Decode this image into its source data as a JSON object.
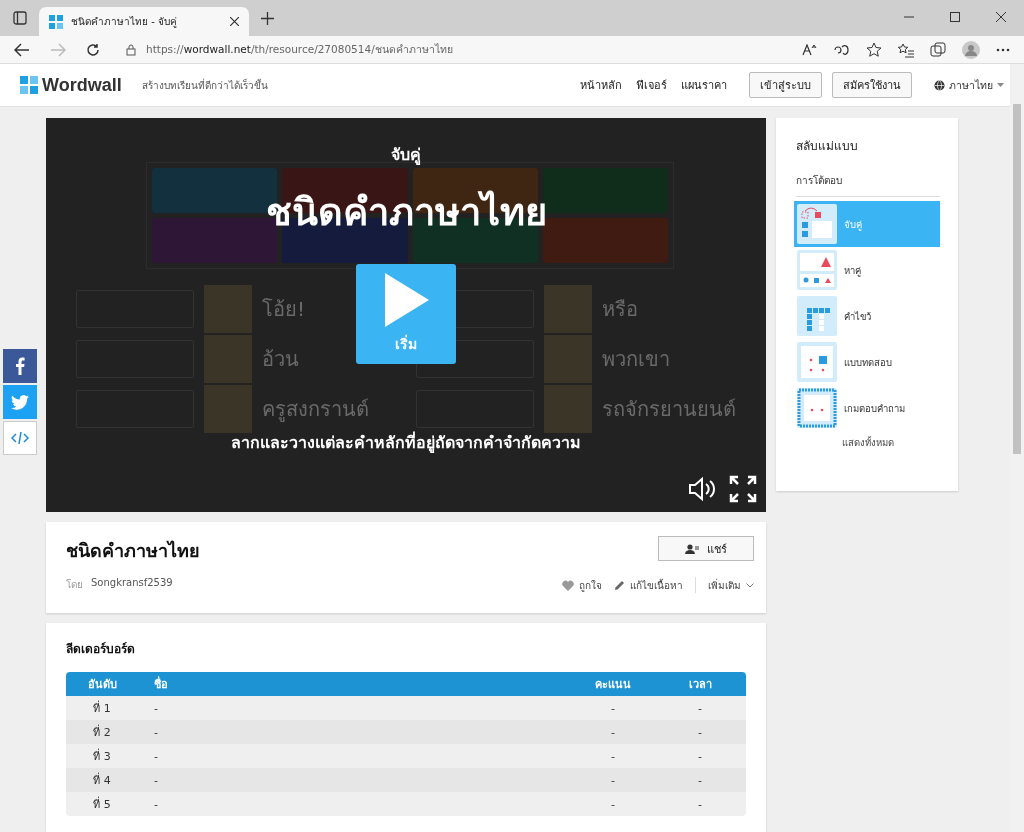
{
  "browser": {
    "tab_title": "ชนิดคำภาษาไทย - จับคู่",
    "url_scheme": "https://",
    "url_host": "wordwall.net",
    "url_path": "/th/resource/27080514/ชนดคำภาษาไทย"
  },
  "site_header": {
    "logo": "Wordwall",
    "tagline": "สร้างบทเรียนที่ดีกว่าได้เร็วขึ้น",
    "nav": [
      "หน้าหลัก",
      "ฟีเจอร์",
      "แผนราคา"
    ],
    "login": "เข้าสู่ระบบ",
    "signup": "สมัครใช้งาน",
    "language": "ภาษาไทย"
  },
  "share_side": [
    {
      "kind": "facebook"
    },
    {
      "kind": "twitter"
    },
    {
      "kind": "embed"
    }
  ],
  "game": {
    "template": "จับคู่",
    "title": "ชนิดคำภาษาไทย",
    "start": "เริ่ม",
    "instruction": "ลากและวางแต่ละคำหลักที่อยู่ถัดจากคำจำกัดความ",
    "categories": [
      {
        "color": "#13303f"
      },
      {
        "color": "#3a1515"
      },
      {
        "color": "#3f2612"
      },
      {
        "color": "#102d1b"
      },
      {
        "color": "#2e1636"
      },
      {
        "color": "#151b3d"
      },
      {
        "color": "#103024"
      },
      {
        "color": "#3f1b12"
      }
    ],
    "items_left": [
      "โอ้ย!",
      "อ้วน",
      "ครูสงกรานต์"
    ],
    "items_right": [
      "หรือ",
      "พวกเขา",
      "รถจักรยานยนต์"
    ]
  },
  "activity": {
    "title": "ชนิดคำภาษาไทย",
    "by_label": "โดย",
    "author": "Songkransf2539",
    "share": "แชร์",
    "like": "ถูกใจ",
    "edit": "แก้ไขเนื้อหา",
    "more": "เพิ่มเติม"
  },
  "leaderboard": {
    "title": "ลีดเดอร์บอร์ด",
    "columns": [
      "อันดับ",
      "ชื่อ",
      "คะแนน",
      "เวลา"
    ],
    "rows": [
      [
        "ที่ 1",
        "-",
        "-",
        "-"
      ],
      [
        "ที่ 2",
        "-",
        "-",
        "-"
      ],
      [
        "ที่ 3",
        "-",
        "-",
        "-"
      ],
      [
        "ที่ 4",
        "-",
        "-",
        "-"
      ],
      [
        "ที่ 5",
        "-",
        "-",
        "-"
      ]
    ]
  },
  "template_switcher": {
    "title": "สลับแม่แบบ",
    "section": "การโต้ตอบ",
    "templates": [
      {
        "label": "จับคู่",
        "kind": "match",
        "selected": true
      },
      {
        "label": "หาคู่",
        "kind": "pairs",
        "selected": false
      },
      {
        "label": "คำไขว้",
        "kind": "crossword",
        "selected": false
      },
      {
        "label": "แบบทดสอบ",
        "kind": "quiz",
        "selected": false
      },
      {
        "label": "เกมตอบคำถาม",
        "kind": "gameshow",
        "selected": false
      }
    ],
    "show_all": "แสดงทั้งหมด"
  }
}
